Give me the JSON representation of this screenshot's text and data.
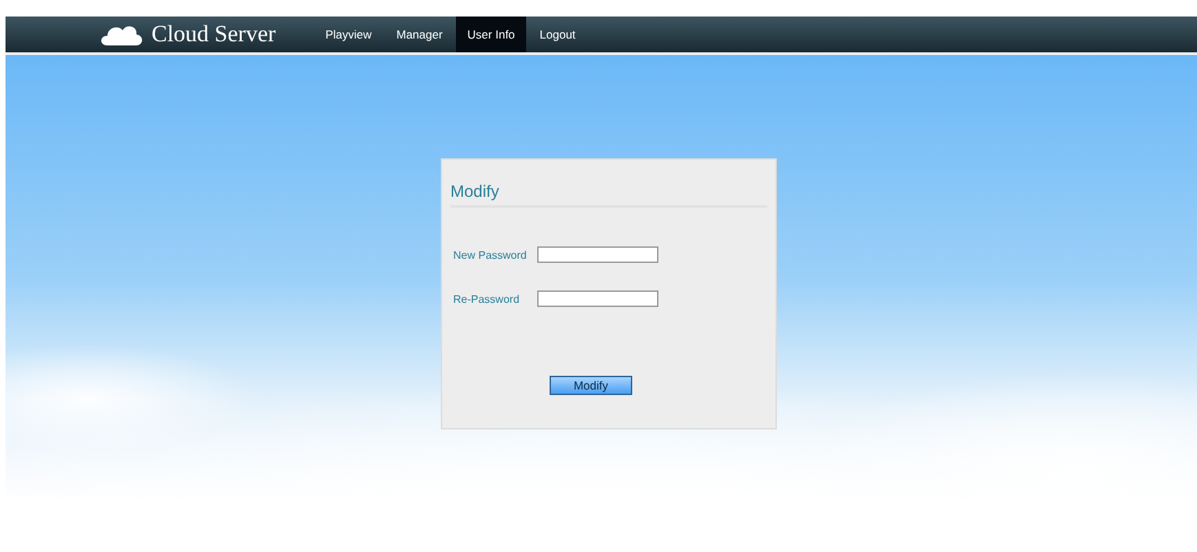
{
  "header": {
    "title": "Cloud Server"
  },
  "nav": [
    {
      "label": "Playview",
      "selected": false
    },
    {
      "label": "Manager",
      "selected": false
    },
    {
      "label": "User Info",
      "selected": true
    },
    {
      "label": "Logout",
      "selected": false
    }
  ],
  "form": {
    "title": "Modify",
    "fields": [
      {
        "label": "New Password"
      },
      {
        "label": "Re-Password"
      }
    ],
    "button": "Modify"
  }
}
